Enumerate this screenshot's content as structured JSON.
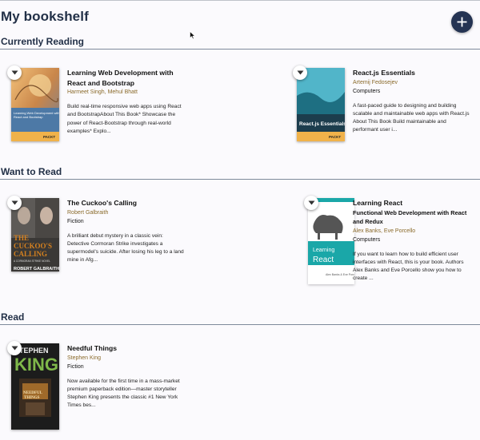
{
  "app": {
    "title": "My bookshelf"
  },
  "shelves": [
    {
      "title": "Currently Reading",
      "books": [
        {
          "title": "Learning Web Development with React and Bootstrap",
          "subtitle": "",
          "authors": "Harmeet Singh, Mehul Bhatt",
          "category": "",
          "description": "Build real-time responsive web apps using React and BootstrapAbout This Book* Showcase the power of React-Bootstrap through real-world examples* Explo...",
          "cover": {
            "title_text": "Learning Web Development with React and Bootstrap",
            "publisher": "PACKT",
            "colors": [
              "#e5a56a",
              "#7fa7c4",
              "#f0b24a"
            ]
          }
        },
        {
          "title": "React.js Essentials",
          "subtitle": "",
          "authors": "Artemij Fedosejev",
          "category": "Computers",
          "description": "A fast-paced guide to designing and building scalable and maintainable web apps with React.js About This Book Build maintainable and performant user i...",
          "cover": {
            "title_text": "React.js Essentials",
            "publisher": "PACKT",
            "colors": [
              "#3a9fb3",
              "#1f5f74",
              "#f0b24a"
            ]
          }
        }
      ]
    },
    {
      "title": "Want to Read",
      "books": [
        {
          "title": "The Cuckoo's Calling",
          "subtitle": "",
          "authors": "Robert Galbraith",
          "category": "Fiction",
          "description": "A brilliant debut mystery in a classic vein: Detective Cormoran Strike investigates a supermodel's suicide. After losing his leg to a land mine in Afg...",
          "cover": {
            "title_text": "THE CUCKOO'S CALLING",
            "tagline": "A CORMORAN STRIKE NOVEL",
            "author_text": "ROBERT GALBRAITH",
            "colors": [
              "#3c3a38",
              "#c9761e",
              "#ffffff"
            ]
          }
        },
        {
          "title": "Learning React",
          "subtitle": "Functional Web Development with React and Redux",
          "authors": "Alex Banks, Eve Porcello",
          "category": "Computers",
          "description": "If you want to learn how to build efficient user interfaces with React, this is your book. Authors Alex Banks and Eve Porcello show you how to create ...",
          "cover": {
            "title_text": "Learning React",
            "publisher": "O'REILLY",
            "author_text": "Alex Banks & Eve Porcello",
            "colors": [
              "#1aa7a8",
              "#ffffff",
              "#555555"
            ]
          }
        }
      ]
    },
    {
      "title": "Read",
      "books": [
        {
          "title": "Needful Things",
          "subtitle": "",
          "authors": "Stephen King",
          "category": "Fiction",
          "description": "Now available for the first time in a mass-market premium paperback edition—master storyteller Stephen King presents the classic #1 New York Times bes...",
          "cover": {
            "title_text": "NEEDFUL THINGS",
            "author_top": "STEPHEN",
            "author_big": "KING",
            "colors": [
              "#1d1d1d",
              "#7fb84a",
              "#a06a2a"
            ]
          }
        }
      ]
    }
  ],
  "icons": {
    "add": "plus-icon",
    "shelf_changer": "triangle-down-icon",
    "cursor": "mouse-pointer-icon"
  }
}
